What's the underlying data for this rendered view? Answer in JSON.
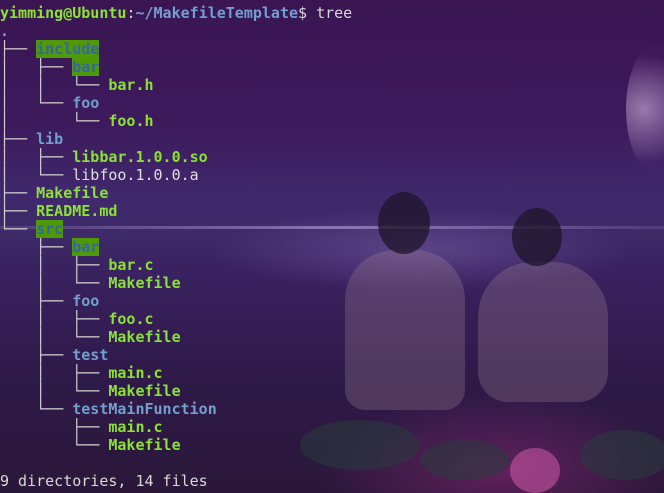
{
  "prompt": {
    "user_host": "yimming@Ubuntu",
    "sep": ":",
    "path": "~/MakefileTemplate",
    "symbol": "$ ",
    "command": "tree"
  },
  "tree": [
    {
      "prefix": "",
      "name": ".",
      "style": "dir"
    },
    {
      "prefix": "├── ",
      "name": "include",
      "style": "dirhl"
    },
    {
      "prefix": "│   ├── ",
      "name": "bar",
      "style": "dirhl"
    },
    {
      "prefix": "│   │   └── ",
      "name": "bar.h",
      "style": "exe"
    },
    {
      "prefix": "│   └── ",
      "name": "foo",
      "style": "dir"
    },
    {
      "prefix": "│       └── ",
      "name": "foo.h",
      "style": "exe"
    },
    {
      "prefix": "├── ",
      "name": "lib",
      "style": "dir"
    },
    {
      "prefix": "│   ├── ",
      "name": "libbar.1.0.0.so",
      "style": "exe"
    },
    {
      "prefix": "│   └── ",
      "name": "libfoo.1.0.0.a",
      "style": "plain"
    },
    {
      "prefix": "├── ",
      "name": "Makefile",
      "style": "exe"
    },
    {
      "prefix": "├── ",
      "name": "README.md",
      "style": "exe"
    },
    {
      "prefix": "└── ",
      "name": "src",
      "style": "dirhl"
    },
    {
      "prefix": "    ├── ",
      "name": "bar",
      "style": "dirhl"
    },
    {
      "prefix": "    │   ├── ",
      "name": "bar.c",
      "style": "exe"
    },
    {
      "prefix": "    │   └── ",
      "name": "Makefile",
      "style": "exe"
    },
    {
      "prefix": "    ├── ",
      "name": "foo",
      "style": "dir"
    },
    {
      "prefix": "    │   ├── ",
      "name": "foo.c",
      "style": "exe"
    },
    {
      "prefix": "    │   └── ",
      "name": "Makefile",
      "style": "exe"
    },
    {
      "prefix": "    ├── ",
      "name": "test",
      "style": "dir"
    },
    {
      "prefix": "    │   ├── ",
      "name": "main.c",
      "style": "exe"
    },
    {
      "prefix": "    │   └── ",
      "name": "Makefile",
      "style": "exe"
    },
    {
      "prefix": "    └── ",
      "name": "testMainFunction",
      "style": "dir"
    },
    {
      "prefix": "        ├── ",
      "name": "main.c",
      "style": "exe"
    },
    {
      "prefix": "        └── ",
      "name": "Makefile",
      "style": "exe"
    }
  ],
  "summary": "9 directories, 14 files"
}
